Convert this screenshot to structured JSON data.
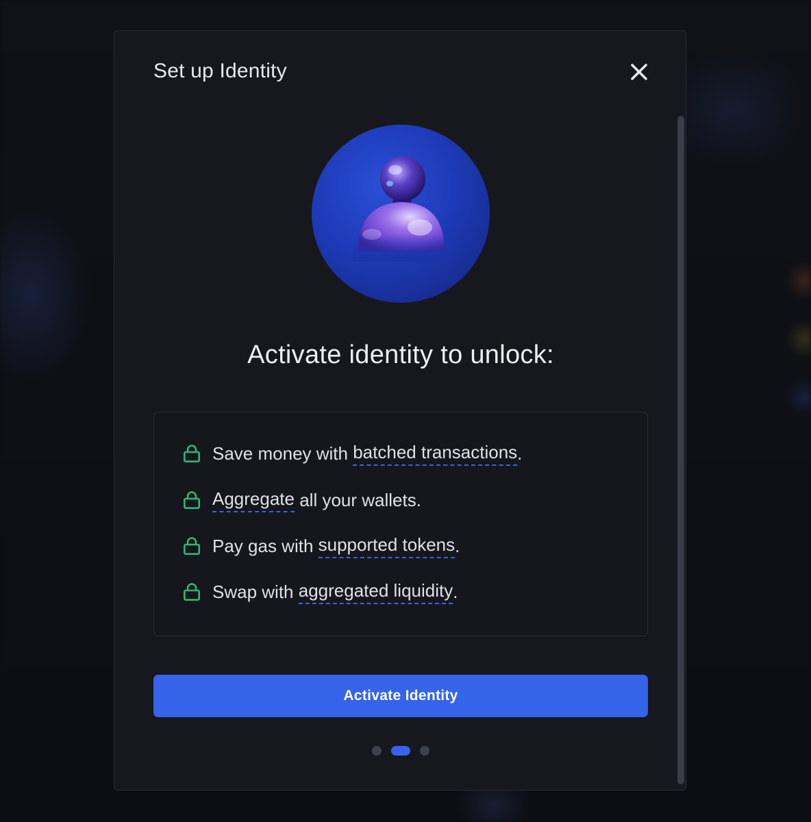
{
  "modal": {
    "title": "Set up Identity",
    "close_icon": "close-icon"
  },
  "hero": {
    "icon": "identity-avatar-icon",
    "background_color": "#1e3ab8"
  },
  "headline": "Activate identity to unlock:",
  "features": [
    {
      "prefix": "Save money with ",
      "link": "batched transactions",
      "suffix": ".",
      "icon": "lock-icon"
    },
    {
      "prefix": "",
      "link": "Aggregate",
      "suffix": " all your wallets.",
      "icon": "lock-icon"
    },
    {
      "prefix": "Pay gas with ",
      "link": "supported tokens",
      "suffix": ".",
      "icon": "lock-icon"
    },
    {
      "prefix": "Swap with ",
      "link": "aggregated liquidity",
      "suffix": ".",
      "icon": "lock-icon"
    }
  ],
  "cta": {
    "label": "Activate Identity",
    "color": "#3563ea"
  },
  "pager": {
    "total": 3,
    "active_index": 1
  },
  "colors": {
    "accent": "#3563ea",
    "lock_icon": "#2fb872",
    "link_underline": "#3b62e8",
    "modal_bg": "#16181e"
  }
}
